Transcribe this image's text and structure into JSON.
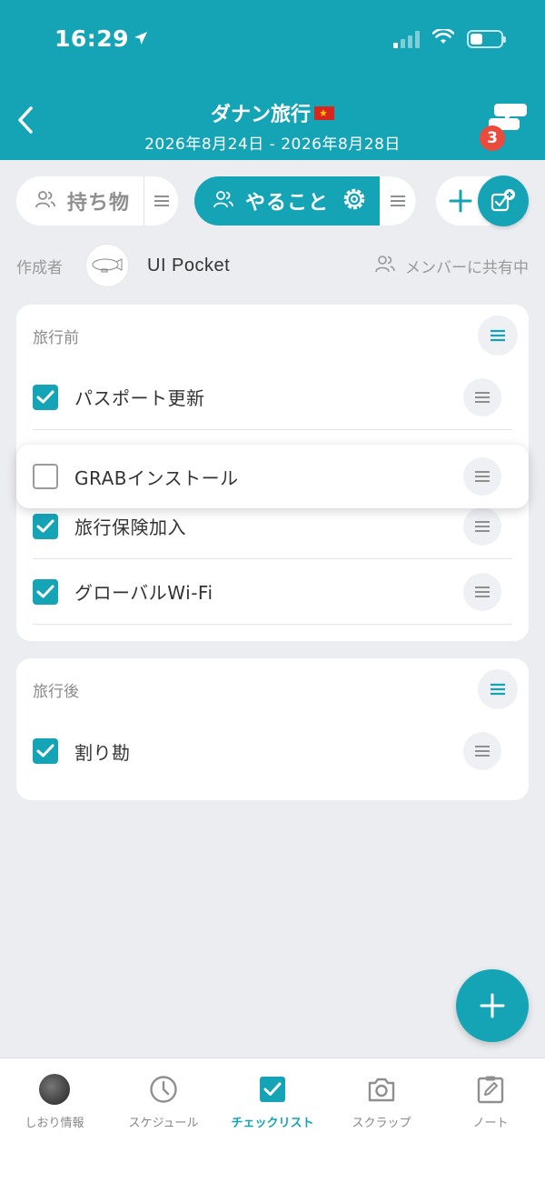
{
  "status_bar": {
    "time": "16:29"
  },
  "header": {
    "trip_title": "ダナン旅行",
    "trip_dates": "2026年8月24日 - 2026年8月28日",
    "chat_badge_count": "3",
    "accent_color": "#14a4b6",
    "flag_icon": "vietnam-flag-icon"
  },
  "tabs": [
    {
      "label": "持ち物",
      "active": false
    },
    {
      "label": "やること",
      "active": true
    }
  ],
  "author": {
    "label": "作成者",
    "name": "UI Pocket",
    "share_status": "メンバーに共有中"
  },
  "sections": [
    {
      "title": "旅行前",
      "items": [
        {
          "label": "パスポート更新",
          "checked": true
        },
        {
          "label": "GRABインストール",
          "checked": false,
          "dragging": true
        },
        {
          "label": "旅行保険加入",
          "checked": true
        },
        {
          "label": "グローバルWi-Fi",
          "checked": true
        }
      ]
    },
    {
      "title": "旅行後",
      "items": [
        {
          "label": "割り勘",
          "checked": true
        }
      ]
    }
  ],
  "bottom_nav": [
    {
      "label": "しおり情報",
      "icon": "avatar-icon",
      "active": false
    },
    {
      "label": "スケジュール",
      "icon": "clock-icon",
      "active": false
    },
    {
      "label": "チェックリスト",
      "icon": "checkbox-icon",
      "active": true
    },
    {
      "label": "スクラップ",
      "icon": "camera-icon",
      "active": false
    },
    {
      "label": "ノート",
      "icon": "note-edit-icon",
      "active": false
    }
  ]
}
